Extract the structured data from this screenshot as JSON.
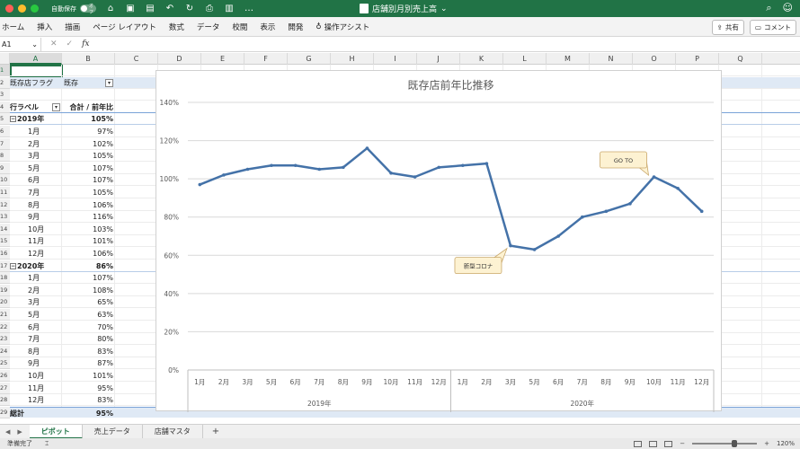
{
  "titlebar": {
    "autosave_label": "自動保存",
    "autosave_state": "オフ",
    "doc_title": "店舗別月別売上高"
  },
  "ribbon": {
    "tabs": [
      "ホーム",
      "挿入",
      "描画",
      "ページ レイアウト",
      "数式",
      "データ",
      "校閲",
      "表示",
      "開発"
    ],
    "assist": "操作アシスト",
    "share": "共有",
    "comment": "コメント"
  },
  "formula": {
    "namebox": "A1",
    "fx": "fx"
  },
  "grid": {
    "columns": [
      "A",
      "B",
      "C",
      "D",
      "E",
      "F",
      "G",
      "H",
      "I",
      "J",
      "K",
      "L",
      "M",
      "N",
      "O",
      "P",
      "Q"
    ],
    "rows": [
      "1",
      "2",
      "3",
      "4",
      "5",
      "6",
      "7",
      "8",
      "9",
      "10",
      "11",
      "12",
      "13",
      "14",
      "15",
      "16",
      "17",
      "18",
      "19",
      "20",
      "21",
      "22",
      "23",
      "24",
      "25",
      "26",
      "27",
      "28",
      "29"
    ]
  },
  "pivot": {
    "filter_label": "既存店フラグ",
    "filter_value": "既存",
    "row_label": "行ラベル",
    "value_label": "合計 / 前年比",
    "groups": [
      {
        "year": "2019年",
        "total": "105%",
        "months": [
          {
            "m": "1月",
            "v": "97%"
          },
          {
            "m": "2月",
            "v": "102%"
          },
          {
            "m": "3月",
            "v": "105%"
          },
          {
            "m": "5月",
            "v": "107%"
          },
          {
            "m": "6月",
            "v": "107%"
          },
          {
            "m": "7月",
            "v": "105%"
          },
          {
            "m": "8月",
            "v": "106%"
          },
          {
            "m": "9月",
            "v": "116%"
          },
          {
            "m": "10月",
            "v": "103%"
          },
          {
            "m": "11月",
            "v": "101%"
          },
          {
            "m": "12月",
            "v": "106%"
          }
        ]
      },
      {
        "year": "2020年",
        "total": "86%",
        "months": [
          {
            "m": "1月",
            "v": "107%"
          },
          {
            "m": "2月",
            "v": "108%"
          },
          {
            "m": "3月",
            "v": "65%"
          },
          {
            "m": "5月",
            "v": "63%"
          },
          {
            "m": "6月",
            "v": "70%"
          },
          {
            "m": "7月",
            "v": "80%"
          },
          {
            "m": "8月",
            "v": "83%"
          },
          {
            "m": "9月",
            "v": "87%"
          },
          {
            "m": "10月",
            "v": "101%"
          },
          {
            "m": "11月",
            "v": "95%"
          },
          {
            "m": "12月",
            "v": "83%"
          }
        ]
      }
    ],
    "grand_total_label": "総計",
    "grand_total": "95%"
  },
  "chart_data": {
    "type": "line",
    "title": "既存店前年比推移",
    "categories": [
      "1月",
      "2月",
      "3月",
      "5月",
      "6月",
      "7月",
      "8月",
      "9月",
      "10月",
      "11月",
      "12月",
      "1月",
      "2月",
      "3月",
      "5月",
      "6月",
      "7月",
      "8月",
      "9月",
      "10月",
      "11月",
      "12月"
    ],
    "groups": [
      {
        "name": "2019年",
        "count": 11
      },
      {
        "name": "2020年",
        "count": 11
      }
    ],
    "values": [
      97,
      102,
      105,
      107,
      107,
      105,
      106,
      116,
      103,
      101,
      106,
      107,
      108,
      65,
      63,
      70,
      80,
      83,
      87,
      101,
      95,
      83
    ],
    "ylim": [
      0,
      140
    ],
    "yticks": [
      "0%",
      "20%",
      "40%",
      "60%",
      "80%",
      "100%",
      "120%",
      "140%"
    ],
    "grid": true,
    "color": "#4472a8",
    "annotations": [
      {
        "text": "新型コロナ",
        "index": 13
      },
      {
        "text": "GO TO",
        "index": 19
      }
    ]
  },
  "sheets": {
    "tabs": [
      "ピボット",
      "売上データ",
      "店舗マスタ"
    ],
    "active": "ピボット",
    "add": "+"
  },
  "status": {
    "ready": "準備完了",
    "zoom": "120%"
  }
}
